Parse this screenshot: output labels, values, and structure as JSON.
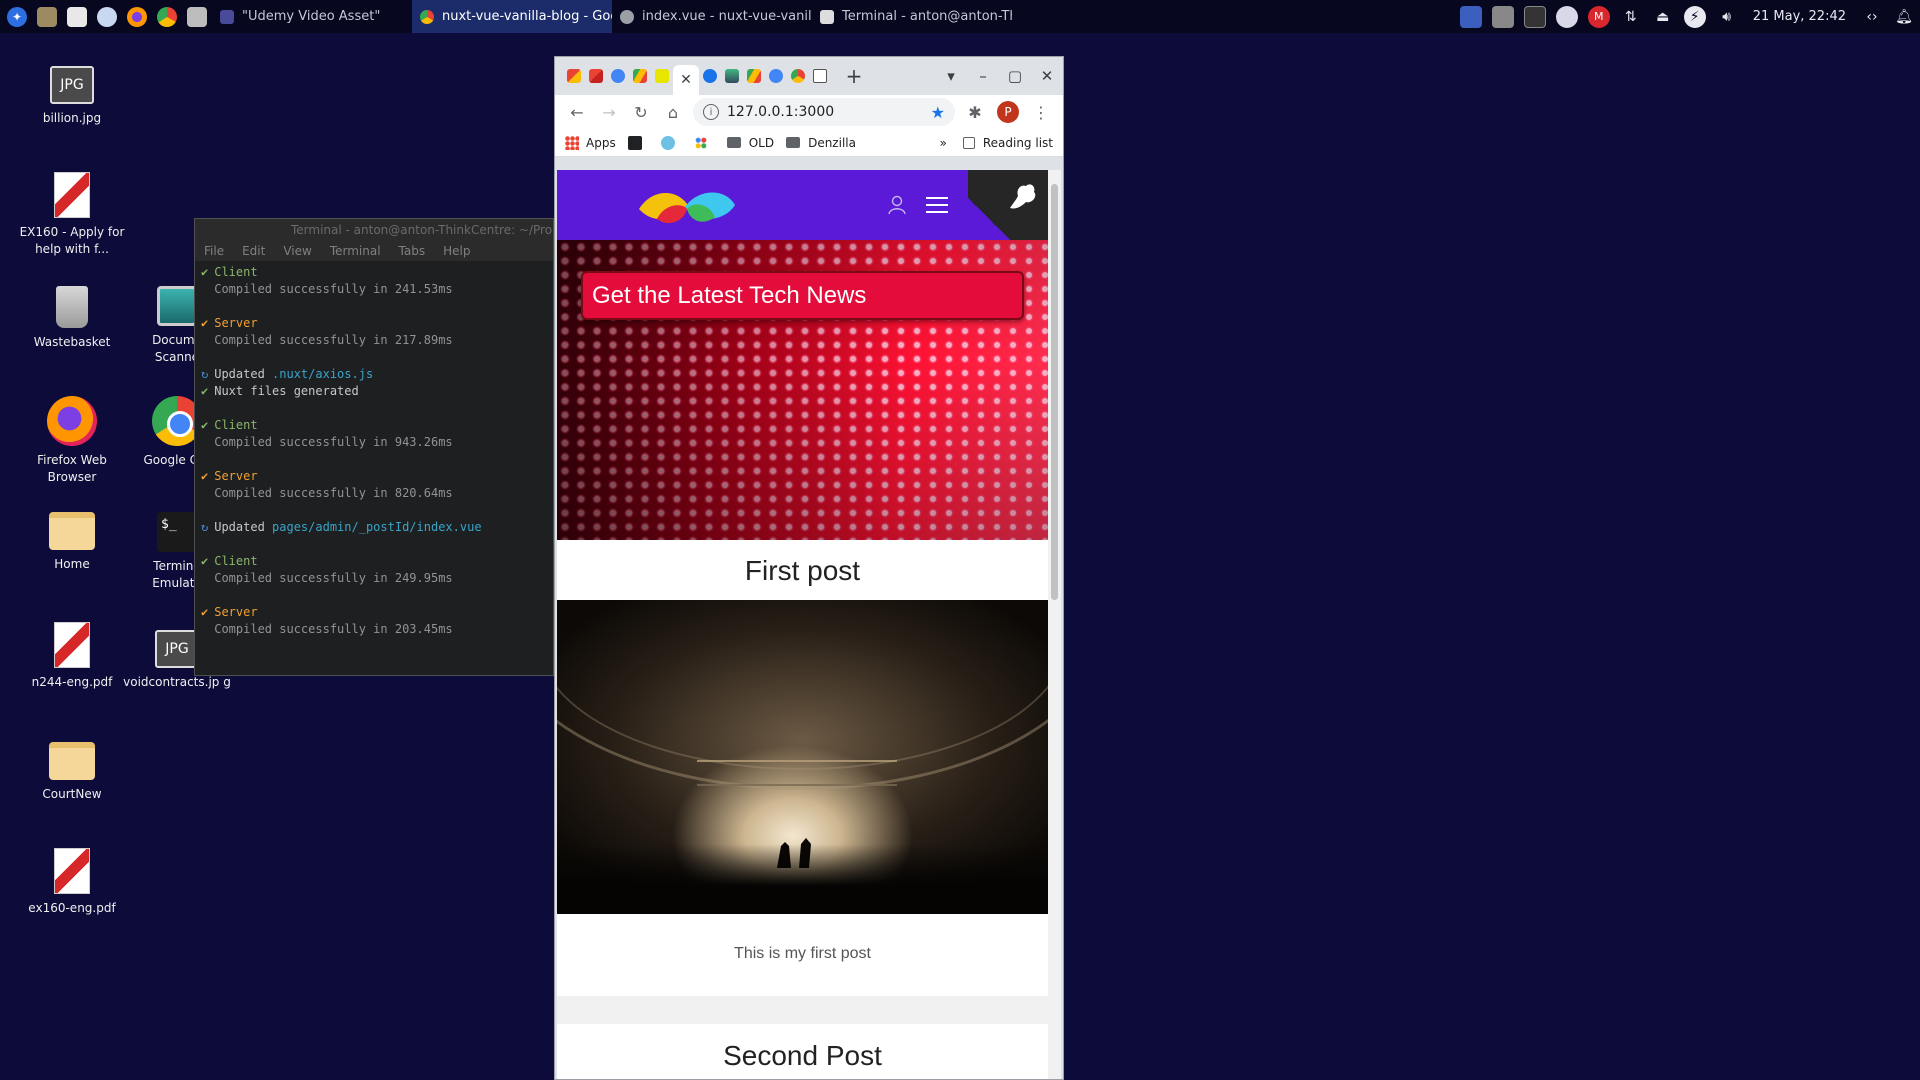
{
  "taskbar": {
    "tasks": [
      {
        "label": "\"Udemy Video Asset\"",
        "color": "#4a4a9a"
      },
      {
        "label": "nuxt-vue-vanilla-blog - Goog...",
        "color": "#34a853"
      },
      {
        "label": "index.vue - nuxt-vue-vanilla-...",
        "color": "#9aa0a6"
      },
      {
        "label": "Terminal - anton@anton-Thi...",
        "color": "#dddddd"
      }
    ],
    "clock": "21 May, 22:42"
  },
  "desktop": {
    "icons": [
      {
        "label": "billion.jpg"
      },
      {
        "label": "EX160 - Apply for help with f..."
      },
      {
        "label": "Wastebasket"
      },
      {
        "label": "Docume Scanne"
      },
      {
        "label": "Firefox Web Browser"
      },
      {
        "label": "Google Chr"
      },
      {
        "label": "Home"
      },
      {
        "label": "Termina Emulato"
      },
      {
        "label": "n244-eng.pdf"
      },
      {
        "label": "voidcontracts.jp g"
      },
      {
        "label": "CourtNew"
      },
      {
        "label": "ex160-eng.pdf"
      }
    ],
    "jpg_glyph": "JPG",
    "term_glyph": "$_"
  },
  "terminal": {
    "title": "Terminal - anton@anton-ThinkCentre: ~/Pro",
    "menu": [
      "File",
      "Edit",
      "View",
      "Terminal",
      "Tabs",
      "Help"
    ],
    "lines": {
      "l1": "Client",
      "l2": "Compiled successfully in 241.53ms",
      "l3": "Server",
      "l4": "Compiled successfully in 217.89ms",
      "l5a": "Updated ",
      "l5b": ".nuxt/axios.js",
      "l6": "Nuxt files generated",
      "l7": "Client",
      "l8": "Compiled successfully in 943.26ms",
      "l9": "Server",
      "l10": "Compiled successfully in 820.64ms",
      "l11a": "Updated ",
      "l11b": "pages/admin/_postId/index.vue",
      "l12": "Client",
      "l13": "Compiled successfully in 249.95ms",
      "l14": "Server",
      "l15": "Compiled successfully in 203.45ms"
    }
  },
  "browser": {
    "url": "127.0.0.1:3000",
    "profile_initial": "P",
    "bookmarks": {
      "apps": "Apps",
      "old": "OLD",
      "denzilla": "Denzilla",
      "more": "»",
      "reading_list": "Reading list"
    },
    "page": {
      "banner": "Get the Latest Tech News",
      "posts": [
        {
          "title": "First post",
          "excerpt": "This is my first post"
        },
        {
          "title": "Second Post"
        }
      ]
    }
  }
}
